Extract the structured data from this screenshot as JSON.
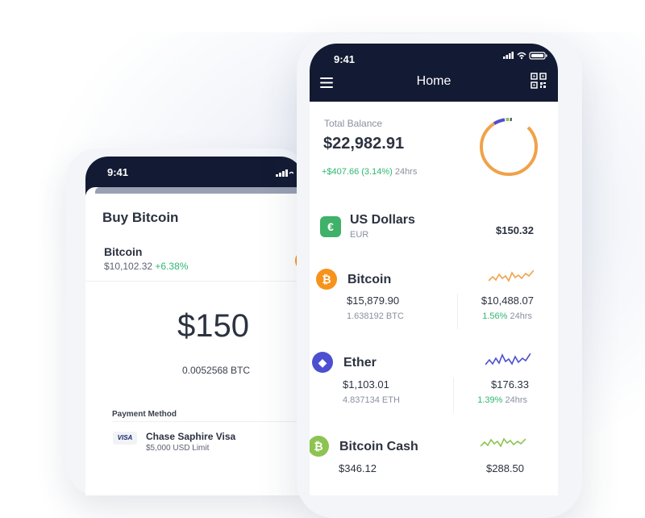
{
  "colors": {
    "navy": "#131a33",
    "green": "#2eb872",
    "bitcoin": "#f7931a",
    "usd": "#3fb169",
    "ether": "#4c4fcf",
    "bitcoin_cash": "#8dc351",
    "donut_orange": "#f0a24a"
  },
  "back_phone": {
    "status_time": "9:41",
    "title": "Buy Bitcoin",
    "coin": {
      "name": "Bitcoin",
      "price": "$10,102.32",
      "change": "+6.38%"
    },
    "amount": "$150",
    "btc_amount": "0.0052568 BTC",
    "payment": {
      "label": "Payment Method",
      "card_brand": "VISA",
      "card_name": "Chase Saphire Visa",
      "limit": "$5,000 USD Limit"
    }
  },
  "front_phone": {
    "status_time": "9:41",
    "title": "Home",
    "balance": {
      "label": "Total Balance",
      "value": "$22,982.91",
      "change": "+$407.66 (3.14%)",
      "period": "24hrs"
    },
    "assets": [
      {
        "name": "US Dollars",
        "sub": "EUR",
        "value": "$150.32",
        "icon": "euro-icon"
      },
      {
        "name": "Bitcoin",
        "price": "$15,879.90",
        "holding": "1.638192 BTC",
        "value": "$10,488.07",
        "change": "1.56%",
        "period": "24hrs",
        "icon": "bitcoin-icon"
      },
      {
        "name": "Ether",
        "price": "$1,103.01",
        "holding": "4.837134 ETH",
        "value": "$176.33",
        "change": "1.39%",
        "period": "24hrs",
        "icon": "ether-icon"
      },
      {
        "name": "Bitcoin Cash",
        "price": "$346.12",
        "value": "$288.50",
        "icon": "bitcoin-cash-icon"
      }
    ]
  }
}
